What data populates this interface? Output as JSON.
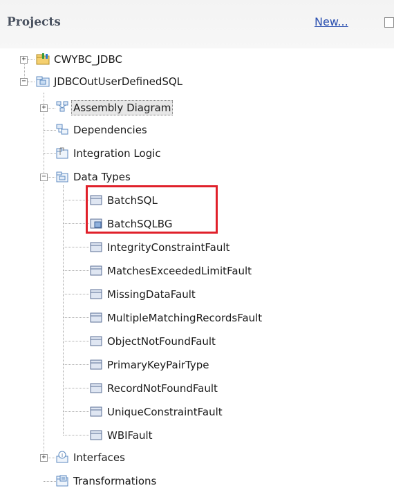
{
  "header": {
    "title": "Projects",
    "new_link": "New..."
  },
  "tree": {
    "projects": [
      {
        "label": "CWYBC_JDBC",
        "icon": "project-folder-icon"
      },
      {
        "label": "JDBCOutUserDefinedSQL",
        "icon": "module-folder-icon",
        "children": {
          "assembly": "Assembly Diagram",
          "dependencies": "Dependencies",
          "integration_logic": "Integration Logic",
          "data_types": {
            "label": "Data Types",
            "items": [
              "BatchSQL",
              "BatchSQLBG",
              "IntegrityConstraintFault",
              "MatchesExceededLimitFault",
              "MissingDataFault",
              "MultipleMatchingRecordsFault",
              "ObjectNotFoundFault",
              "PrimaryKeyPairType",
              "RecordNotFoundFault",
              "UniqueConstraintFault",
              "WBIFault"
            ]
          },
          "interfaces": "Interfaces",
          "transformations": "Transformations"
        }
      }
    ]
  },
  "colors": {
    "highlight_border": "#e0202a",
    "link": "#2a4fb0",
    "title": "#4a5260"
  }
}
